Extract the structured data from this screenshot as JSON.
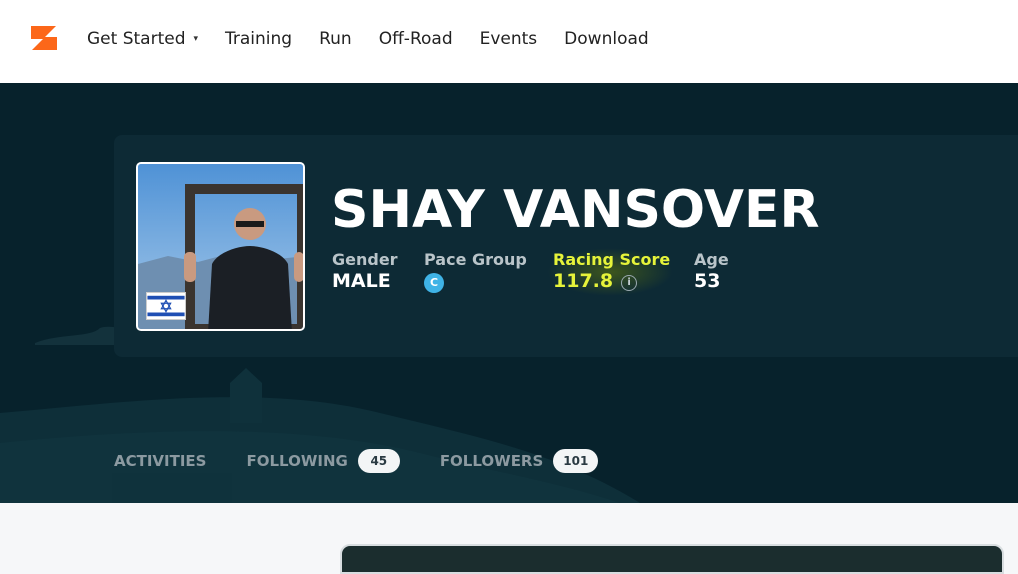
{
  "nav": {
    "items": [
      {
        "label": "Get Started",
        "has_dropdown": true
      },
      {
        "label": "Training"
      },
      {
        "label": "Run"
      },
      {
        "label": "Off-Road"
      },
      {
        "label": "Events"
      },
      {
        "label": "Download"
      }
    ],
    "caret": "▾"
  },
  "profile": {
    "name": "SHAY VANSOVER",
    "stats": {
      "gender": {
        "label": "Gender",
        "value": "MALE"
      },
      "pace_group": {
        "label": "Pace Group",
        "value": "C"
      },
      "racing_score": {
        "label": "Racing Score",
        "value": "117.8"
      },
      "age": {
        "label": "Age",
        "value": "53"
      }
    },
    "info_glyph": "i"
  },
  "tabs": {
    "activities": {
      "label": "ACTIVITIES"
    },
    "following": {
      "label": "FOLLOWING",
      "count": "45"
    },
    "followers": {
      "label": "FOLLOWERS",
      "count": "101"
    }
  },
  "colors": {
    "brand": "#fc6719",
    "hero_bg": "#07222c",
    "racing_score": "#e6f33a",
    "pace_badge": "#3fb3e6"
  },
  "icons": {
    "logo": "zwift-logo-icon",
    "flag": "israel-flag-icon",
    "info": "info-icon"
  }
}
